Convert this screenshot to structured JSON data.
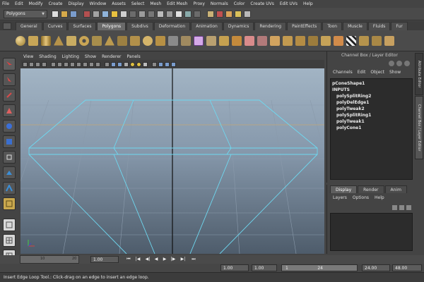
{
  "menubar": {
    "items": [
      "File",
      "Edit",
      "Modify",
      "Create",
      "Display",
      "Window",
      "Assets",
      "Select",
      "Mesh",
      "Edit Mesh",
      "Proxy",
      "Normals",
      "Color",
      "Create UVs",
      "Edit UVs",
      "Help"
    ]
  },
  "statusline": {
    "mode": "Polygons"
  },
  "shelf": {
    "tabs": [
      "General",
      "Curves",
      "Surfaces",
      "Polygons",
      "Subdivs",
      "Deformation",
      "Animation",
      "Dynamics",
      "Rendering",
      "PaintEffects",
      "Toon",
      "Muscle",
      "Fluids",
      "Fur"
    ],
    "active_tab": "Polygons"
  },
  "panel": {
    "menus": [
      "View",
      "Shading",
      "Lighting",
      "Show",
      "Renderer",
      "Panels"
    ]
  },
  "channel_box": {
    "title": "Channel Box / Layer Editor",
    "menus": [
      "Channels",
      "Edit",
      "Object",
      "Show"
    ],
    "shape_name": "pConeShape1",
    "inputs_label": "INPUTS",
    "inputs": [
      "polySplitRing2",
      "polyDelEdge1",
      "polyTweak2",
      "polySplitRing1",
      "polyTweak1",
      "polyCone1"
    ]
  },
  "layer_editor": {
    "tabs": [
      "Display",
      "Render",
      "Anim"
    ],
    "active_tab": "Display",
    "menus": [
      "Layers",
      "Options",
      "Help"
    ]
  },
  "side_tabs": {
    "attribute_editor": "Attribute Editor",
    "channel_box": "Channel Box / Layer Editor"
  },
  "time_slider": {
    "ticks": [
      "10",
      "20"
    ],
    "current_time": "1.00",
    "start_time": "1.00",
    "playback_start": "1.00",
    "range_start": "1",
    "range_end": "24",
    "playback_end": "24.00",
    "end_time": "48.00"
  },
  "help_line": {
    "text": "Insert Edge Loop Tool.: Click-drag on an edge to insert an edge loop."
  },
  "colors": {
    "wireframe": "#6ed8f0",
    "viewport_top": "#a2b4c4",
    "viewport_bottom": "#4e5c6b",
    "ui_background": "#444444"
  }
}
